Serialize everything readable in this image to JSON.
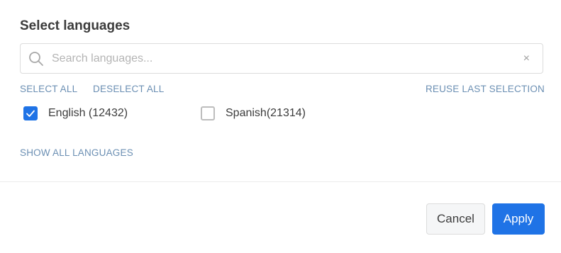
{
  "dialog": {
    "title": "Select languages"
  },
  "search": {
    "placeholder": "Search languages...",
    "value": "",
    "clear_glyph": "×"
  },
  "actions": {
    "select_all": "SELECT ALL",
    "deselect_all": "DESELECT ALL",
    "reuse_last": "REUSE LAST SELECTION",
    "show_all": "SHOW ALL LANGUAGES"
  },
  "languages": [
    {
      "label": "English (12432)",
      "checked": true
    },
    {
      "label": "Spanish(21314)",
      "checked": false
    }
  ],
  "footer": {
    "cancel_label": "Cancel",
    "apply_label": "Apply"
  },
  "colors": {
    "accent": "#1f73e6",
    "link": "#6b8fb3",
    "title": "#3c3c3c"
  },
  "icons": {
    "search": "search-icon",
    "clear": "close-icon",
    "check": "checkmark-icon"
  }
}
